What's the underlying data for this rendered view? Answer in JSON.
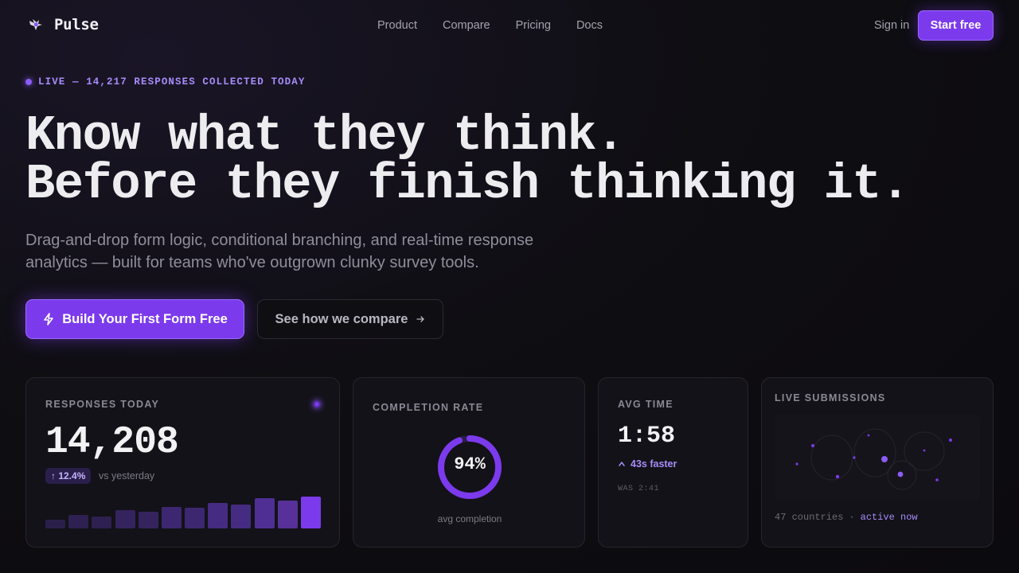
{
  "nav": {
    "brand": "Pulse",
    "brand_icon": "bird-logo-icon",
    "links": [
      "Product",
      "Compare",
      "Pricing",
      "Docs"
    ],
    "sign_in": "Sign in",
    "start_free": "Start free"
  },
  "hero": {
    "live_badge": "LIVE — 14,217 RESPONSES COLLECTED TODAY",
    "headline_line1": "Know what they think.",
    "headline_line2": "Before they finish thinking it.",
    "subheadline": "Drag-and-drop form logic, conditional branching, and real-time response analytics — built for teams who've outgrown clunky survey tools.",
    "cta_primary": "Build Your First Form Free",
    "cta_primary_icon": "lightning-icon",
    "cta_secondary": "See how we compare",
    "cta_secondary_icon": "arrow-right-icon"
  },
  "cards": {
    "responses": {
      "label": "RESPONSES TODAY",
      "value": "14,208",
      "change": "↑ 12.4%",
      "change_context": "vs yesterday",
      "bar_levels": [
        0.26,
        0.38,
        0.33,
        0.52,
        0.47,
        0.62,
        0.58,
        0.72,
        0.68,
        0.86,
        0.8,
        0.9
      ],
      "bar_colors": [
        "#2a1e4a",
        "#2e2050",
        "#2e2050",
        "#35235e",
        "#35235e",
        "#3d2770",
        "#3d2770",
        "#462b82",
        "#462b82",
        "#4f2f94",
        "#573199",
        "#7c3aed"
      ]
    },
    "completion": {
      "label": "COMPLETION RATE",
      "value": "94%",
      "ratio": 0.94,
      "caption": "avg completion"
    },
    "avg_time": {
      "label": "AVG TIME",
      "value": "1:58",
      "delta": "43s faster",
      "previous": "WAS 2:41"
    },
    "live": {
      "label": "LIVE SUBMISSIONS",
      "countries": "47 countries",
      "separator": "·",
      "status": "active now"
    }
  },
  "colors": {
    "accent": "#7c3aed",
    "accent_light": "#a78bfa"
  }
}
